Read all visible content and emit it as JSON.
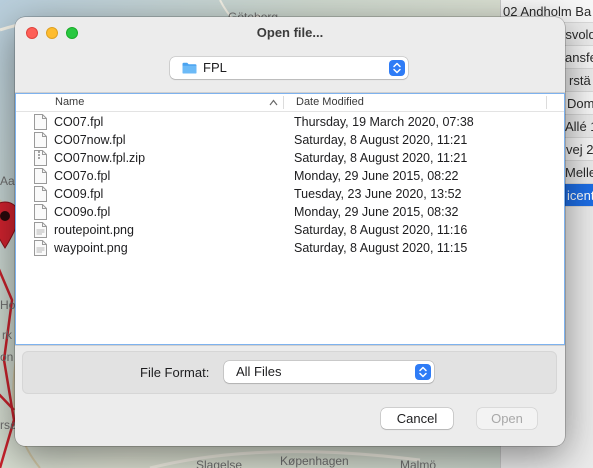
{
  "background_map": {
    "labels": [
      "Göteborg",
      "Aal",
      "Holte",
      "rk",
      "on",
      "rsø",
      "Slagelse",
      "Køpenhagen",
      "Malmö"
    ]
  },
  "side_list": {
    "rows": [
      "02 Andholm Ba",
      "rsvold",
      "ansfel",
      "rstä",
      "Dom",
      "Allé 1",
      "vej 2",
      "Melle",
      "icento"
    ]
  },
  "dialog": {
    "title": "Open file...",
    "folder": {
      "label": "FPL",
      "icon": "folder-icon"
    },
    "columns": {
      "name": "Name",
      "date": "Date Modified"
    },
    "files": [
      {
        "name": "CO07.fpl",
        "date": "Thursday, 19 March 2020, 07:38",
        "icon": "document-icon"
      },
      {
        "name": "CO07now.fpl",
        "date": "Saturday, 8 August 2020, 11:21",
        "icon": "document-icon"
      },
      {
        "name": "CO07now.fpl.zip",
        "date": "Saturday, 8 August 2020, 11:21",
        "icon": "zip-file-icon"
      },
      {
        "name": "CO07o.fpl",
        "date": "Monday, 29 June 2015, 08:22",
        "icon": "document-icon"
      },
      {
        "name": "CO09.fpl",
        "date": "Tuesday, 23 June 2020, 13:52",
        "icon": "document-icon"
      },
      {
        "name": "CO09o.fpl",
        "date": "Monday, 29 June 2015, 08:32",
        "icon": "document-icon"
      },
      {
        "name": "routepoint.png",
        "date": "Saturday, 8 August 2020, 11:16",
        "icon": "image-file-icon"
      },
      {
        "name": "waypoint.png",
        "date": "Saturday, 8 August 2020, 11:15",
        "icon": "image-file-icon"
      }
    ],
    "format": {
      "label": "File Format:",
      "value": "All Files"
    },
    "buttons": {
      "cancel": "Cancel",
      "open": "Open"
    },
    "colors": {
      "accent": "#2f7cf6",
      "close": "#fe5f57",
      "minimize": "#febc2e",
      "maximize": "#28c840",
      "selection": "#1d6ee6"
    }
  }
}
